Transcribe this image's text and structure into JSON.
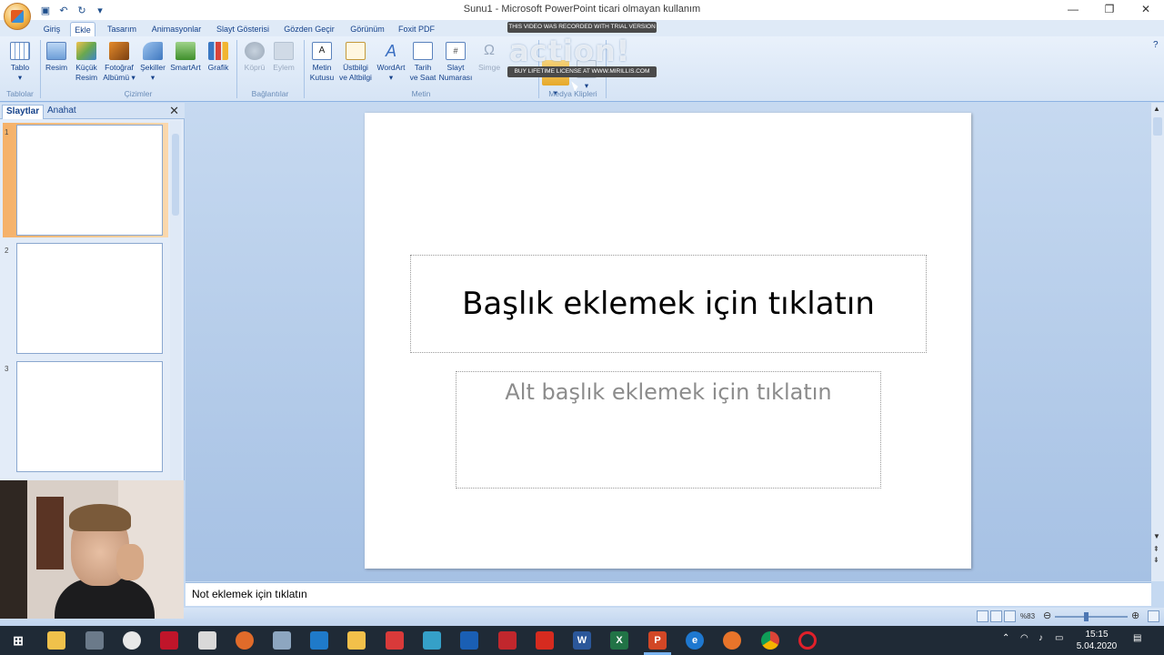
{
  "window": {
    "title": "Sunu1 - Microsoft PowerPoint ticari olmayan kullanım",
    "controls": [
      "minimize-icon",
      "restore-icon",
      "close-icon"
    ]
  },
  "ribbon_tabs": [
    {
      "label": "Giriş"
    },
    {
      "label": "Ekle",
      "active": true
    },
    {
      "label": "Tasarım"
    },
    {
      "label": "Animasyonlar"
    },
    {
      "label": "Slayt Gösterisi"
    },
    {
      "label": "Gözden Geçir"
    },
    {
      "label": "Görünüm"
    },
    {
      "label": "Foxit PDF"
    }
  ],
  "ribbon": {
    "groups": {
      "tablolar": "Tablolar",
      "cizimler": "Çizimler",
      "baglantilar": "Bağlantılar",
      "metin": "Metin",
      "medya": "Medya Klipleri"
    },
    "buttons": {
      "tablo": "Tablo",
      "resim": "Resim",
      "kucuk_resim_1": "Küçük",
      "kucuk_resim_2": "Resim",
      "fotograf_1": "Fotoğraf",
      "fotograf_2": "Albümü",
      "sekiller": "Şekiller",
      "smartart": "SmartArt",
      "grafik": "Grafik",
      "kopru": "Köprü",
      "eylem": "Eylem",
      "metin_kutusu_1": "Metin",
      "metin_kutusu_2": "Kutusu",
      "ustbilgi_1": "Üstbilgi",
      "ustbilgi_2": "ve Altbilgi",
      "wordart": "WordArt",
      "tarih_1": "Tarih",
      "tarih_2": "ve Saat",
      "slayt_no_1": "Slayt",
      "slayt_no_2": "Numarası",
      "simge": "Simge"
    }
  },
  "watermark": {
    "top": "THIS VIDEO WAS RECORDED WITH TRIAL VERSION",
    "bottom": "BUY LIFETIME LICENSE AT WWW.MIRILLIS.COM"
  },
  "left_pane": {
    "tabs": [
      "Slaytlar",
      "Anahat"
    ],
    "slides": [
      {
        "num": "1",
        "selected": true
      },
      {
        "num": "2"
      },
      {
        "num": "3"
      }
    ]
  },
  "slide": {
    "title_placeholder": "Başlık eklemek için tıklatın",
    "subtitle_placeholder": "Alt başlık eklemek için tıklatın"
  },
  "notes": {
    "placeholder": "Not eklemek için tıklatın"
  },
  "statusbar": {
    "zoom": "%83"
  },
  "taskbar": {
    "time": "15:15",
    "date": "5.04.2020"
  },
  "colors": {
    "ribbon_bg": "#dfeaf7",
    "canvas_bg": "#a6c1e4",
    "selection_accent": "#f3a64a",
    "taskbar_bg": "#1f2a36"
  }
}
